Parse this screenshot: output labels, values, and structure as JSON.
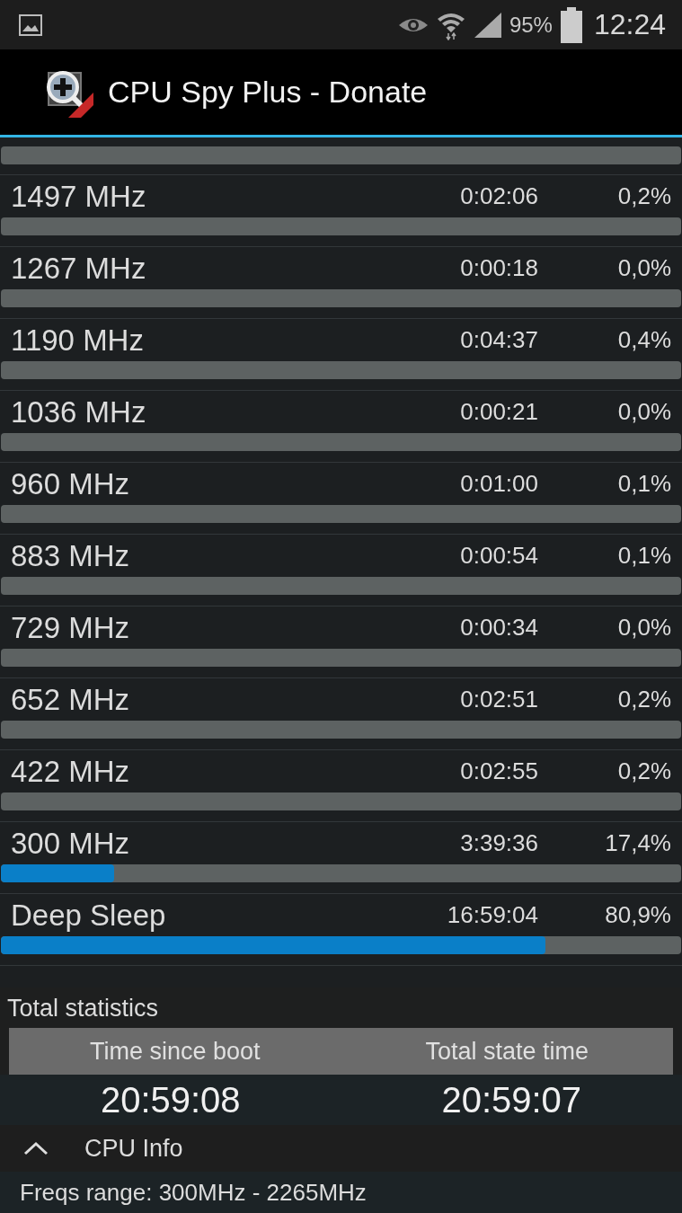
{
  "status_bar": {
    "battery": "95%",
    "time": "12:24"
  },
  "action_bar": {
    "title": "CPU Spy Plus - Donate"
  },
  "clipped_row": {
    "level": 0
  },
  "states": [
    {
      "name": "1497 MHz",
      "time": "0:02:06",
      "percent": "0,2%",
      "level": 0
    },
    {
      "name": "1267 MHz",
      "time": "0:00:18",
      "percent": "0,0%",
      "level": 0
    },
    {
      "name": "1190 MHz",
      "time": "0:04:37",
      "percent": "0,4%",
      "level": 0
    },
    {
      "name": "1036 MHz",
      "time": "0:00:21",
      "percent": "0,0%",
      "level": 0
    },
    {
      "name": "960 MHz",
      "time": "0:01:00",
      "percent": "0,1%",
      "level": 0
    },
    {
      "name": "883 MHz",
      "time": "0:00:54",
      "percent": "0,1%",
      "level": 0
    },
    {
      "name": "729 MHz",
      "time": "0:00:34",
      "percent": "0,0%",
      "level": 0
    },
    {
      "name": "652 MHz",
      "time": "0:02:51",
      "percent": "0,2%",
      "level": 0
    },
    {
      "name": "422 MHz",
      "time": "0:02:55",
      "percent": "0,2%",
      "level": 0
    },
    {
      "name": "300 MHz",
      "time": "3:39:36",
      "percent": "17,4%",
      "level": 0.167
    },
    {
      "name": "Deep Sleep",
      "time": "16:59:04",
      "percent": "80,9%",
      "level": 0.8
    }
  ],
  "total_statistics": {
    "title": "Total statistics",
    "columns": [
      {
        "header": "Time since boot",
        "value": "20:59:08"
      },
      {
        "header": "Total state time",
        "value": "20:59:07"
      }
    ]
  },
  "cpu_info": {
    "title": "CPU Info",
    "expanded": true,
    "text": "Freqs range: 300MHz - 2265MHz"
  }
}
